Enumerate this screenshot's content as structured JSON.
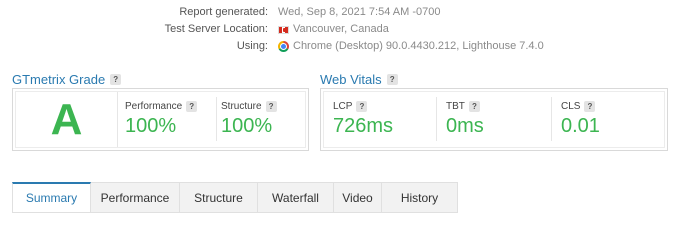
{
  "report": {
    "generated_label": "Report generated:",
    "generated_value": "Wed, Sep 8, 2021 7:54 AM -0700",
    "location_label": "Test Server Location:",
    "location_value": "Vancouver, Canada",
    "location_flag": "canada-flag-icon",
    "using_label": "Using:",
    "using_value": "Chrome (Desktop) 90.0.4430.212, Lighthouse 7.4.0",
    "using_icon": "chrome-icon"
  },
  "grade": {
    "title": "GTmetrix Grade",
    "help": "?",
    "letter": "A",
    "performance_label": "Performance",
    "performance_value": "100%",
    "structure_label": "Structure",
    "structure_value": "100%"
  },
  "vitals": {
    "title": "Web Vitals",
    "help": "?",
    "lcp_label": "LCP",
    "lcp_value": "726ms",
    "tbt_label": "TBT",
    "tbt_value": "0ms",
    "cls_label": "CLS",
    "cls_value": "0.01"
  },
  "tabs": [
    {
      "label": "Summary",
      "active": true
    },
    {
      "label": "Performance",
      "active": false
    },
    {
      "label": "Structure",
      "active": false
    },
    {
      "label": "Waterfall",
      "active": false
    },
    {
      "label": "Video",
      "active": false
    },
    {
      "label": "History",
      "active": false
    }
  ],
  "colors": {
    "accent": "#2a7ab0",
    "good": "#3cb551"
  }
}
